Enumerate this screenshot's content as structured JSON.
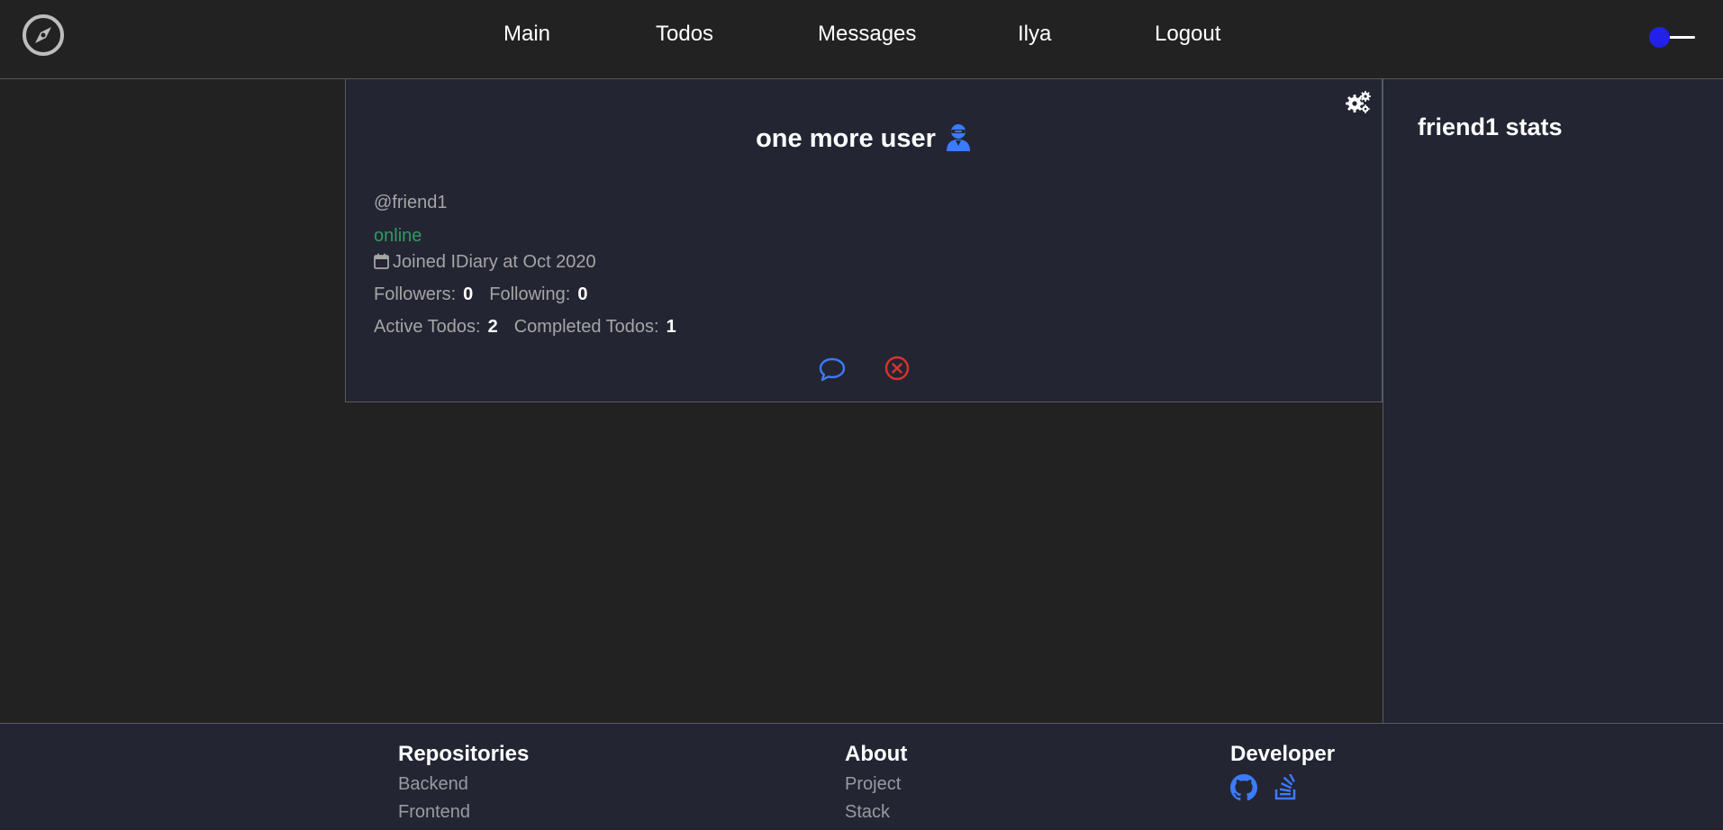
{
  "header": {
    "logo_icon": "compass-icon",
    "nav": [
      {
        "label": "Main"
      },
      {
        "label": "Todos"
      },
      {
        "label": "Messages"
      },
      {
        "label": "Ilya"
      },
      {
        "label": "Logout"
      }
    ],
    "theme_toggle": {
      "state": "on",
      "knob_color": "#2121e8"
    }
  },
  "profile": {
    "settings_icon": "gears-icon",
    "display_name": "one more user",
    "badge_icon": "user-ninja-icon",
    "username": "@friend1",
    "status": "online",
    "joined_icon": "calendar-icon",
    "joined": "Joined IDiary at Oct 2020",
    "followers_label": "Followers:",
    "followers": "0",
    "following_label": "Following:",
    "following": "0",
    "active_todos_label": "Active Todos:",
    "active_todos": "2",
    "completed_todos_label": "Completed Todos:",
    "completed_todos": "1",
    "actions": [
      {
        "icon": "chat-bubble-icon",
        "color": "#3b7bff"
      },
      {
        "icon": "remove-friend-icon",
        "color": "#d9342b"
      }
    ]
  },
  "stats": {
    "title": "friend1 stats"
  },
  "footer": {
    "repositories": {
      "heading": "Repositories",
      "links": [
        "Backend",
        "Frontend"
      ]
    },
    "about": {
      "heading": "About",
      "links": [
        "Project",
        "Stack"
      ]
    },
    "developer": {
      "heading": "Developer",
      "icons": [
        "github-icon",
        "stackoverflow-icon"
      ]
    }
  },
  "colors": {
    "background": "#222222",
    "panel": "#242533",
    "accent": "#3b7bff",
    "online": "#2f9b62",
    "danger": "#d9342b",
    "muted_text": "#a5a5a5"
  }
}
